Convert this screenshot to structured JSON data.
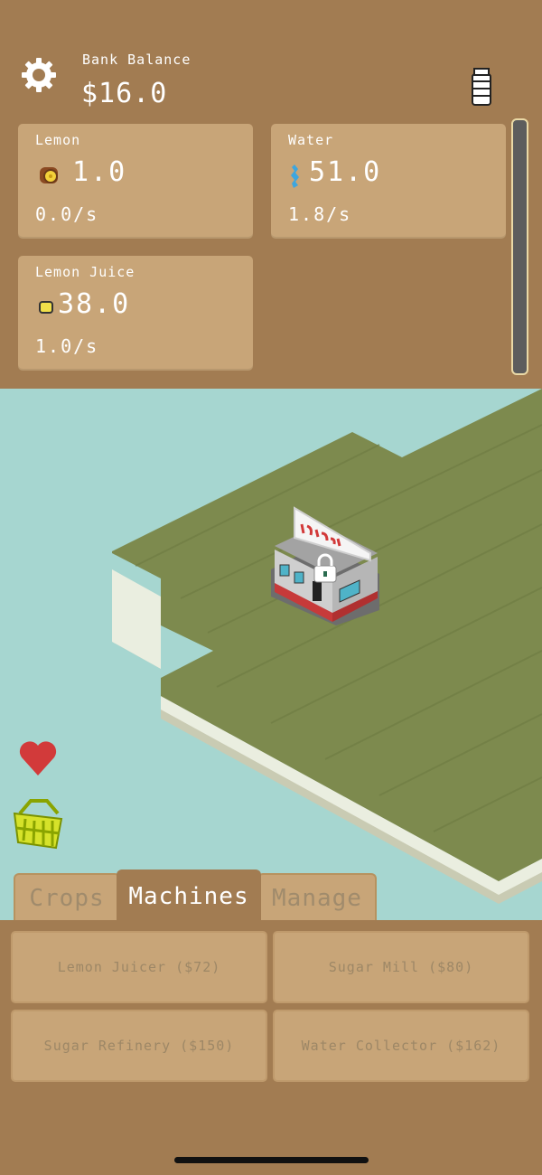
{
  "header": {
    "bank_label": "Bank Balance",
    "bank_value": "$16.0"
  },
  "resources": [
    {
      "name": "Lemon",
      "amount": "1.0",
      "rate": "0.0/s",
      "icon": "lemon-icon"
    },
    {
      "name": "Water",
      "amount": "51.0",
      "rate": "1.8/s",
      "icon": "water-drop-icon"
    },
    {
      "name": "Lemon Juice",
      "amount": "38.0",
      "rate": "1.0/s",
      "icon": "lemon-juice-icon"
    }
  ],
  "scene": {
    "building_sign": "Diner"
  },
  "tabs": [
    {
      "label": "Crops",
      "active": false
    },
    {
      "label": "Machines",
      "active": true
    },
    {
      "label": "Manage",
      "active": false
    }
  ],
  "shop": [
    {
      "label": "Lemon Juicer ($72)"
    },
    {
      "label": "Sugar Mill ($80)"
    },
    {
      "label": "Sugar Refinery ($150)"
    },
    {
      "label": "Water Collector ($162)"
    }
  ],
  "colors": {
    "background": "#a27c52",
    "card": "#c8a578",
    "water": "#a6d6d0",
    "grass": "#7d8a4e"
  }
}
